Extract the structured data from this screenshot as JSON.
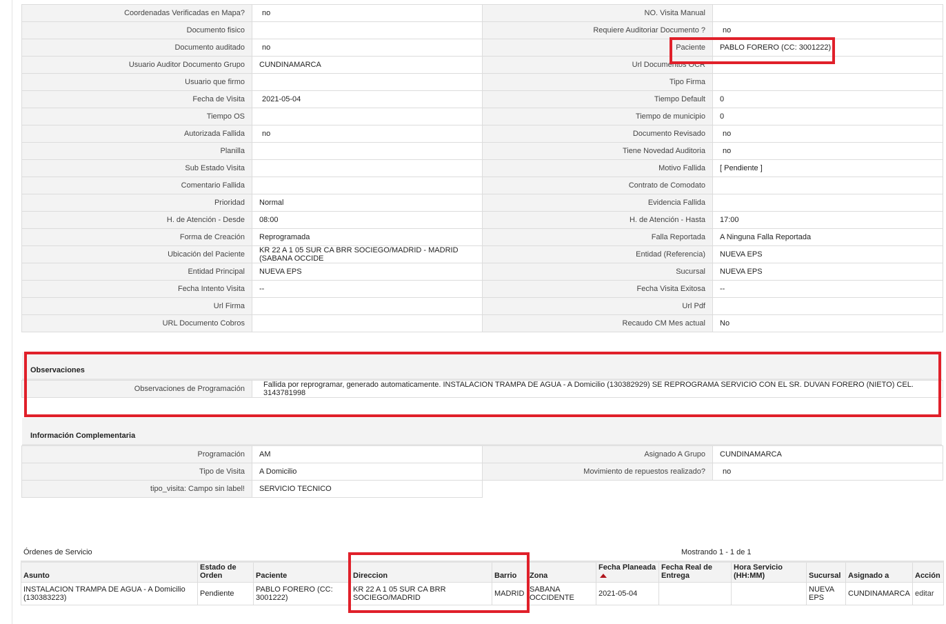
{
  "details": [
    {
      "l1": "Coordenadas Verificadas en Mapa?",
      "v1": "no",
      "l2": "NO. Visita Manual",
      "v2": ""
    },
    {
      "l1": "Documento fisico",
      "v1": "",
      "l2": "Requiere Auditoriar Documento ?",
      "v2": "no"
    },
    {
      "l1": "Documento auditado",
      "v1": "no",
      "l2": "Paciente",
      "v2": "PABLO FORERO (CC: 3001222)"
    },
    {
      "l1": "Usuario Auditor Documento Grupo",
      "v1": "CUNDINAMARCA",
      "l2": "Url Documentos OCR",
      "v2": ""
    },
    {
      "l1": "Usuario que firmo",
      "v1": "",
      "l2": "Tipo Firma",
      "v2": ""
    },
    {
      "l1": "Fecha de Visita",
      "v1": "2021-05-04",
      "l2": "Tiempo Default",
      "v2": "0"
    },
    {
      "l1": "Tiempo OS",
      "v1": "",
      "l2": "Tiempo de municipio",
      "v2": "0"
    },
    {
      "l1": "Autorizada Fallida",
      "v1": "no",
      "l2": "Documento Revisado",
      "v2": "no"
    },
    {
      "l1": "Planilla",
      "v1": "",
      "l2": "Tiene Novedad Auditoria",
      "v2": "no"
    },
    {
      "l1": "Sub Estado Visita",
      "v1": "",
      "l2": "Motivo Fallida",
      "v2": "[ Pendiente ]"
    },
    {
      "l1": "Comentario Fallida",
      "v1": "",
      "l2": "Contrato de Comodato",
      "v2": ""
    },
    {
      "l1": "Prioridad",
      "v1": "Normal",
      "l2": "Evidencia Fallida",
      "v2": ""
    },
    {
      "l1": "H. de Atención - Desde",
      "v1": "08:00",
      "l2": "H. de Atención - Hasta",
      "v2": "17:00"
    },
    {
      "l1": "Forma de Creación",
      "v1": "Reprogramada",
      "l2": "Falla Reportada",
      "v2": "A Ninguna Falla Reportada"
    },
    {
      "l1": "Ubicación del Paciente",
      "v1": "KR 22 A 1 05 SUR CA BRR SOCIEGO/MADRID - MADRID (SABANA OCCIDE",
      "l2": "Entidad (Referencia)",
      "v2": "NUEVA EPS"
    },
    {
      "l1": "Entidad Principal",
      "v1": "NUEVA EPS",
      "l2": "Sucursal",
      "v2": "NUEVA EPS"
    },
    {
      "l1": "Fecha Intento Visita",
      "v1": "--",
      "l2": "Fecha Visita Exitosa",
      "v2": "--"
    },
    {
      "l1": "Url Firma",
      "v1": "",
      "l2": "Url Pdf",
      "v2": ""
    },
    {
      "l1": "URL Documento Cobros",
      "v1": "",
      "l2": "Recaudo CM Mes actual",
      "v2": "No"
    }
  ],
  "observaciones": {
    "title": "Observaciones",
    "label": "Observaciones de Programación",
    "value": "Fallida por reprogramar, generado automaticamente. INSTALACION TRAMPA DE AGUA - A Domicilio (130382929) SE REPROGRAMA SERVICIO CON EL SR. DUVAN FORERO (NIETO) CEL. 3143781998"
  },
  "complementaria": {
    "title": "Información Complementaria",
    "rows": [
      {
        "l1": "Programación",
        "v1": "AM",
        "l2": "Asignado A Grupo",
        "v2": "CUNDINAMARCA"
      },
      {
        "l1": "Tipo de Visita",
        "v1": "A Domicilio",
        "l2": "Movimiento de repuestos realizado?",
        "v2": "no"
      },
      {
        "l1": "tipo_visita: Campo sin label!",
        "v1": "SERVICIO TECNICO"
      }
    ]
  },
  "orders": {
    "title": "Órdenes de Servicio",
    "count": "Mostrando 1 - 1 de 1",
    "headers": {
      "asunto": "Asunto",
      "estado": "Estado de Orden",
      "paciente": "Paciente",
      "direccion": "Direccion",
      "barrio": "Barrio",
      "zona": "Zona",
      "fecha_planeada": "Fecha Planeada",
      "fecha_real": "Fecha Real de Entrega",
      "hora": "Hora Servicio (HH:MM)",
      "sucursal": "Sucursal",
      "asignado": "Asignado a",
      "accion": "Acción"
    },
    "row": {
      "asunto": "INSTALACION TRAMPA DE AGUA - A Domicilio (130383223)",
      "estado": "Pendiente",
      "paciente": "PABLO FORERO (CC: 3001222)",
      "direccion": "KR 22 A 1 05 SUR CA BRR SOCIEGO/MADRID",
      "barrio": "MADRID",
      "zona": "SABANA OCCIDENTE",
      "fecha_planeada": "2021-05-04",
      "fecha_real": "",
      "hora": "",
      "sucursal": "NUEVA EPS",
      "asignado": "CUNDINAMARCA",
      "accion": "editar"
    }
  },
  "highlight_color": "#e0202a"
}
